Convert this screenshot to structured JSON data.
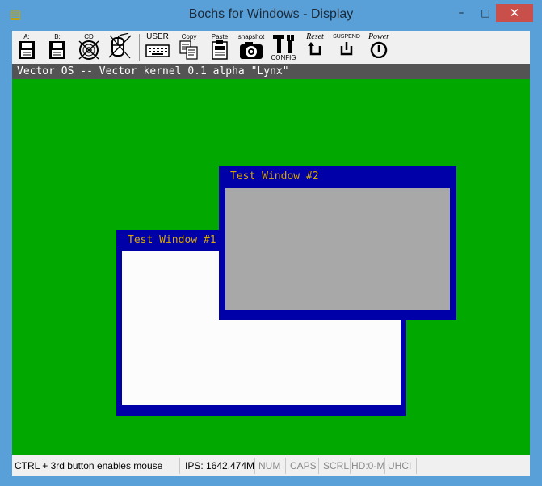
{
  "window": {
    "title": "Bochs for Windows - Display",
    "app_icon": "bochs-icon",
    "controls": {
      "minimize": "–",
      "maximize": "□",
      "close": "✕"
    }
  },
  "toolbar": {
    "floppy_a_label": "A:",
    "floppy_b_label": "B:",
    "cdrom_label": "CD",
    "mouse_icon": "mouse-disabled-icon",
    "user_label": "USER",
    "copy_label": "Copy",
    "paste_label": "Paste",
    "snapshot_label": "snapshot",
    "config_label": "CONFIG",
    "reset_label": "Reset",
    "suspend_label": "SUSPEND",
    "power_label": "Power"
  },
  "guest": {
    "header": "Vector OS -- Vector kernel 0.1 alpha \"Lynx\"",
    "background_color": "#00a800",
    "windows": [
      {
        "title": "Test Window #1",
        "body_color": "#fcfcfc"
      },
      {
        "title": "Test Window #2",
        "body_color": "#a8a8a8"
      }
    ]
  },
  "status": {
    "message": "CTRL + 3rd button enables mouse",
    "ips": "IPS: 1642.474M",
    "num": "NUM",
    "caps": "CAPS",
    "scrl": "SCRL",
    "hd": "HD:0-M",
    "uhci": "UHCI"
  }
}
